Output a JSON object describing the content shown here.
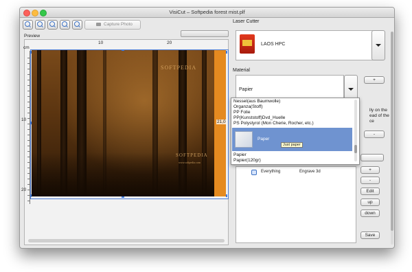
{
  "window": {
    "title": "VisiCut – Softpedia forest mist.plf"
  },
  "toolbar": {
    "capture_label": "Capture Photo"
  },
  "preview": {
    "label": "Preview",
    "unit": "cm",
    "ruler_h": [
      "10",
      "20"
    ],
    "ruler_v": [
      "10",
      "20"
    ],
    "width_readout": "21,0",
    "watermark": "SOFTPEDIA",
    "watermark_small": "www.softpedia.com"
  },
  "right": {
    "laser_cutter_heading": "Laser Cutter",
    "laser_cutter_value": "LAOS HPC",
    "material_heading": "Material",
    "material_value": "Papier",
    "plus_label": "+",
    "minus_label": "-",
    "partial_text": [
      "lly on the",
      "ead of the",
      "ce"
    ],
    "material_options": [
      "Nessel(aus Baumwolle)",
      "Organza(Stoff)",
      "PP Folie",
      "PP(Kunststoff)Dvd_Huelle",
      "PS Polystyrol (Mon Cherie, Rocher, etc.)"
    ],
    "selected_option": "Paper",
    "selected_tooltip": "Just paper",
    "after_options": [
      "Papier",
      "Papier(120gr)"
    ],
    "row_everything": "Everything",
    "row_engrave": "Engrave 3d",
    "buttons": {
      "add": "+",
      "remove": "-",
      "edit": "Edit",
      "up": "up",
      "down": "down",
      "save": "Save"
    }
  }
}
